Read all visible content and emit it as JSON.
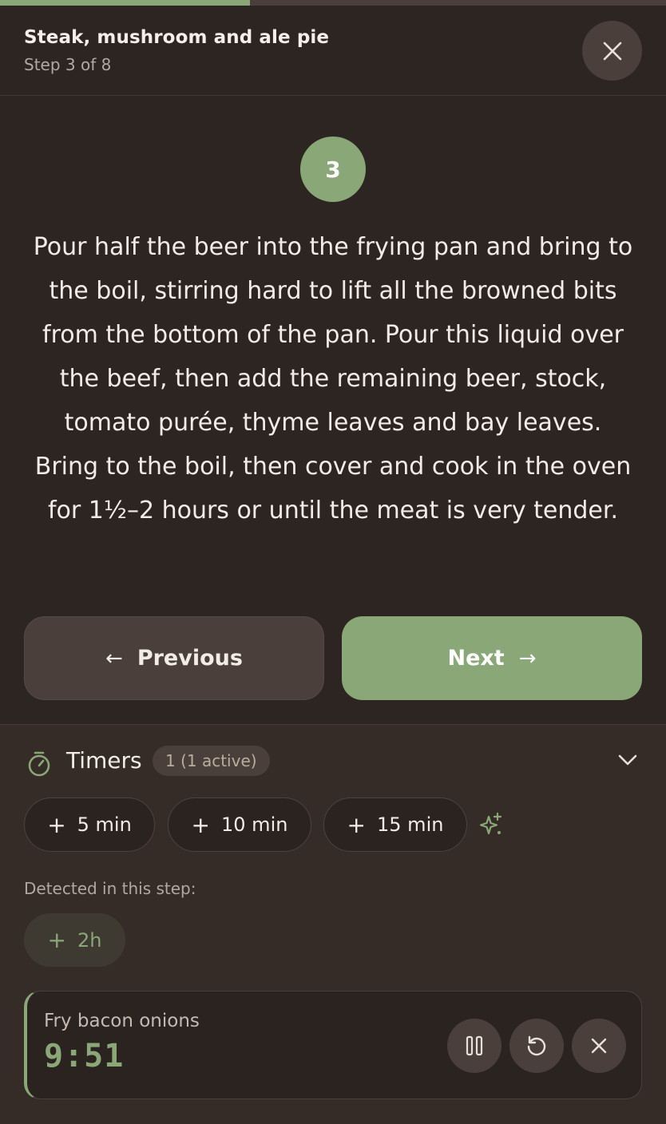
{
  "progress": {
    "current_step": 3,
    "total_steps": 8,
    "fraction": 0.375
  },
  "header": {
    "title": "Steak, mushroom and ale pie",
    "step_label": "Step 3 of 8",
    "close_icon": "close-icon"
  },
  "step": {
    "number": "3",
    "instruction": "Pour half the beer into the frying pan and bring to the boil, stirring hard to lift all the browned bits from the bottom of the pan. Pour this liquid over the beef, then add the remaining beer, stock, tomato purée, thyme leaves and bay leaves. Bring to the boil, then cover and cook in the oven for 1½–2 hours or until the meat is very tender."
  },
  "nav": {
    "prev_arrow": "←",
    "prev_label": "Previous",
    "next_label": "Next",
    "next_arrow": "→"
  },
  "timers": {
    "title": "Timers",
    "count_badge": "1 (1 active)",
    "presets": [
      {
        "plus": "+",
        "label": "5 min"
      },
      {
        "plus": "+",
        "label": "10 min"
      },
      {
        "plus": "+",
        "label": "15 min"
      }
    ],
    "detected_label": "Detected in this step:",
    "detected": [
      {
        "plus": "+",
        "label": "2h"
      }
    ],
    "active": [
      {
        "name": "Fry bacon onions",
        "remaining": "9:51"
      }
    ]
  },
  "colors": {
    "background": "#2d2522",
    "panel": "#352c28",
    "accent": "#8aa778",
    "button": "#4a3f3b",
    "text": "#f3ece6",
    "muted": "#b3a8a1"
  },
  "icons": {
    "timer": "stopwatch-icon",
    "collapse": "chevron-down-icon",
    "suggest": "sparkle-icon",
    "pause": "pause-icon",
    "reset": "reset-icon",
    "delete": "close-icon"
  }
}
